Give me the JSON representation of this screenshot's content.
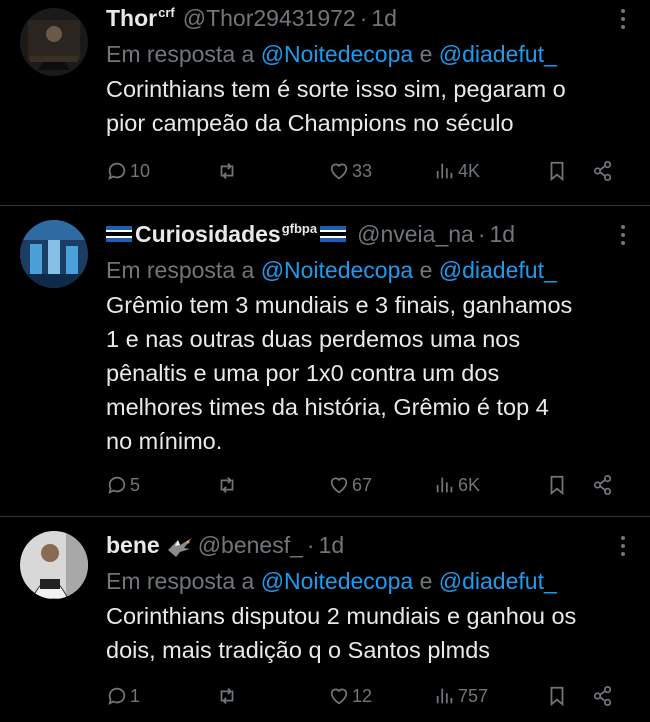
{
  "tweets": [
    {
      "name": "Thor",
      "name_sup": "crf",
      "handle": "@Thor29431972",
      "time": "1d",
      "reply_prefix": "Em resposta a",
      "mention1": "@Noitedecopa",
      "reply_and": "e",
      "mention2": "@diadefut_",
      "text": "Corinthians tem é sorte isso sim, pegaram o\npior campeão da Champions no século",
      "replies": "10",
      "retweets": "",
      "likes": "33",
      "views": "4K"
    },
    {
      "name": "Curiosidades",
      "name_sup": "gfbpa",
      "handle": "@nveia_na",
      "time": "1d",
      "reply_prefix": "Em resposta a",
      "mention1": "@Noitedecopa",
      "reply_and": "e",
      "mention2": "@diadefut_",
      "text": "Grêmio tem 3 mundiais e 3 finais, ganhamos\n1 e nas outras duas perdemos uma nos\npênaltis e uma por 1x0 contra um dos\nmelhores times da história, Grêmio é top 4\nno mínimo.",
      "replies": "5",
      "retweets": "",
      "likes": "67",
      "views": "6K"
    },
    {
      "name": "bene",
      "name_sup": "",
      "handle": "@benesf_",
      "time": "1d",
      "reply_prefix": "Em resposta a",
      "mention1": "@Noitedecopa",
      "reply_and": "e",
      "mention2": "@diadefut_",
      "text": "Corinthians disputou 2 mundiais e ganhou os\ndois, mais tradição q o Santos plmds",
      "replies": "1",
      "retweets": "",
      "likes": "12",
      "views": "757"
    }
  ],
  "icons": {
    "reply": "comment-icon",
    "retweet": "retweet-icon",
    "like": "heart-icon",
    "views": "views-icon",
    "bookmark": "bookmark-icon",
    "share": "share-icon",
    "more": "more-icon"
  },
  "colors": {
    "background": "#000000",
    "text": "#e7e9ea",
    "muted": "#71767b",
    "link": "#1d9bf0",
    "divider": "#2f3336"
  }
}
